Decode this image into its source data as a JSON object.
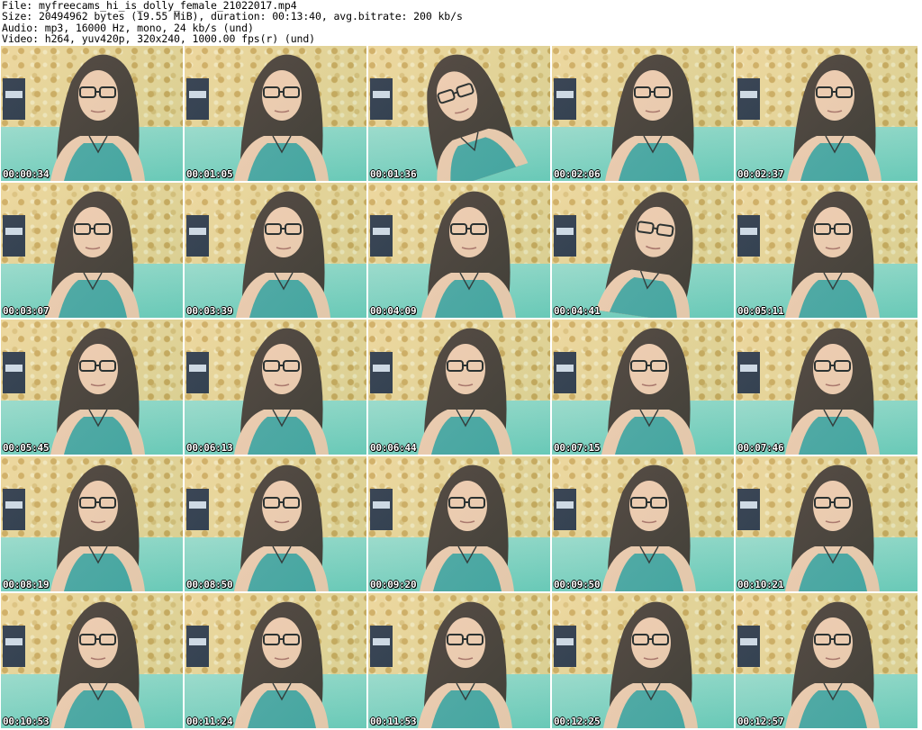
{
  "header": {
    "file": "File: myfreecams_hi_is_dolly_female_21022017.mp4",
    "size": "Size: 20494962 bytes (19.55 MiB), duration: 00:13:40, avg.bitrate: 200 kb/s",
    "audio": "Audio: mp3, 16000 Hz, mono, 24 kb/s (und)",
    "video": "Video: h264, yuv420p, 320x240, 1000.00 fps(r) (und)"
  },
  "thumbnails": [
    "00:00:34",
    "00:01:05",
    "00:01:36",
    "00:02:06",
    "00:02:37",
    "00:03:07",
    "00:03:39",
    "00:04:09",
    "00:04:41",
    "00:05:11",
    "00:05:45",
    "00:06:13",
    "00:06:44",
    "00:07:15",
    "00:07:46",
    "00:08:19",
    "00:08:50",
    "00:09:20",
    "00:09:50",
    "00:10:21",
    "00:10:53",
    "00:11:24",
    "00:11:53",
    "00:12:25",
    "00:12:57"
  ],
  "colors": {
    "wall": "#e9cf8a",
    "teal": "#7ccfbe",
    "hair": "#3a2a22",
    "skin": "#f3c6a6",
    "top": "#3f9f9a"
  }
}
